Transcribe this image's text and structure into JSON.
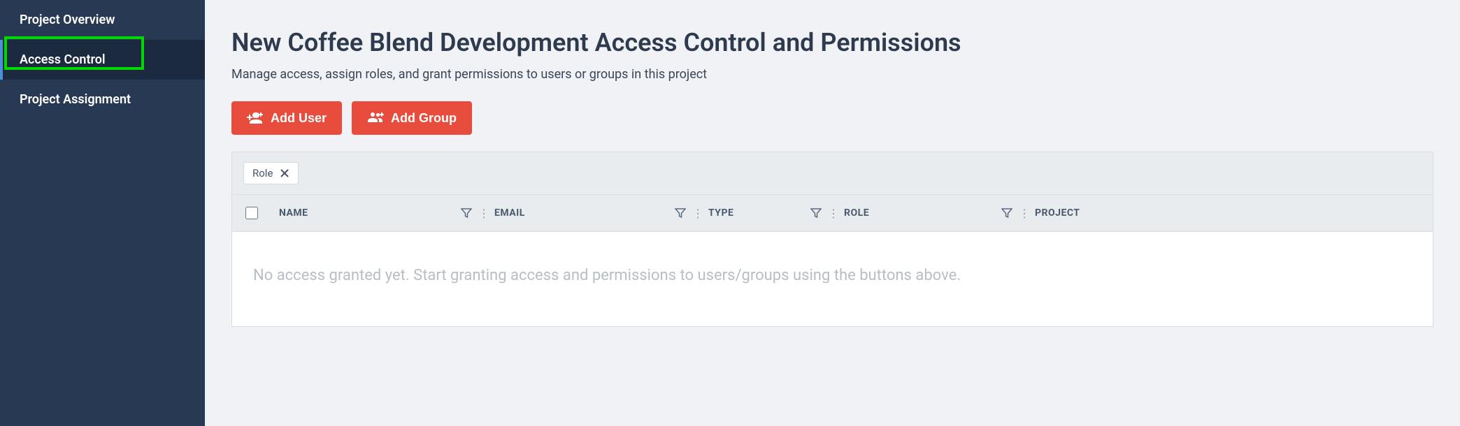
{
  "sidebar": {
    "items": [
      {
        "label": "Project Overview"
      },
      {
        "label": "Access Control"
      },
      {
        "label": "Project Assignment"
      }
    ]
  },
  "header": {
    "title": "New Coffee Blend Development Access Control and Permissions",
    "subtitle": "Manage access, assign roles, and grant permissions to users or groups in this project"
  },
  "buttons": {
    "add_user": "Add User",
    "add_group": "Add Group"
  },
  "filters": {
    "chip_label": "Role"
  },
  "table": {
    "columns": {
      "name": "NAME",
      "email": "EMAIL",
      "type": "TYPE",
      "role": "ROLE",
      "project": "PROJECT"
    },
    "empty_message": "No access granted yet. Start granting access and permissions to users/groups using the buttons above."
  }
}
